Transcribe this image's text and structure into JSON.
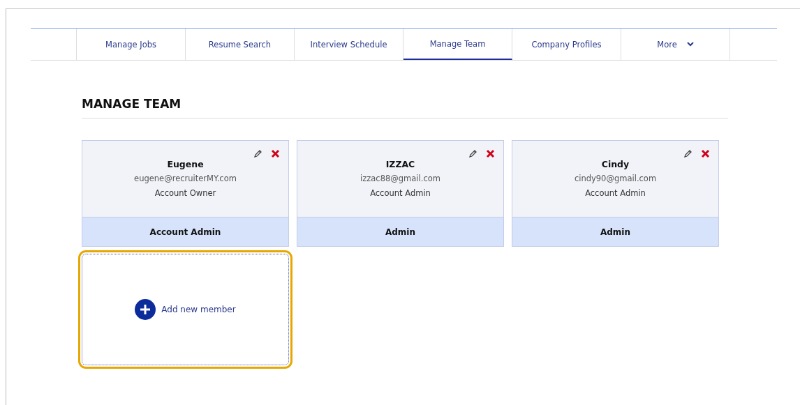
{
  "tabs": [
    {
      "label": "Manage Jobs",
      "selected": false,
      "dropdown": false
    },
    {
      "label": "Resume Search",
      "selected": false,
      "dropdown": false
    },
    {
      "label": "Interview Schedule",
      "selected": false,
      "dropdown": false
    },
    {
      "label": "Manage Team",
      "selected": true,
      "dropdown": false
    },
    {
      "label": "Company Profiles",
      "selected": false,
      "dropdown": false
    },
    {
      "label": "More",
      "selected": false,
      "dropdown": true
    }
  ],
  "heading": "MANAGE TEAM",
  "members": [
    {
      "name": "Eugene",
      "email": "eugene@recruiterMY.com",
      "role": "Account Owner",
      "access": "Account Admin"
    },
    {
      "name": "IZZAC",
      "email": "izzac88@gmail.com",
      "role": "Account Admin",
      "access": "Admin"
    },
    {
      "name": "Cindy",
      "email": "cindy90@gmail.com",
      "role": "Account Admin",
      "access": "Admin"
    }
  ],
  "add_member": {
    "label": "Add new member",
    "focused": true
  }
}
